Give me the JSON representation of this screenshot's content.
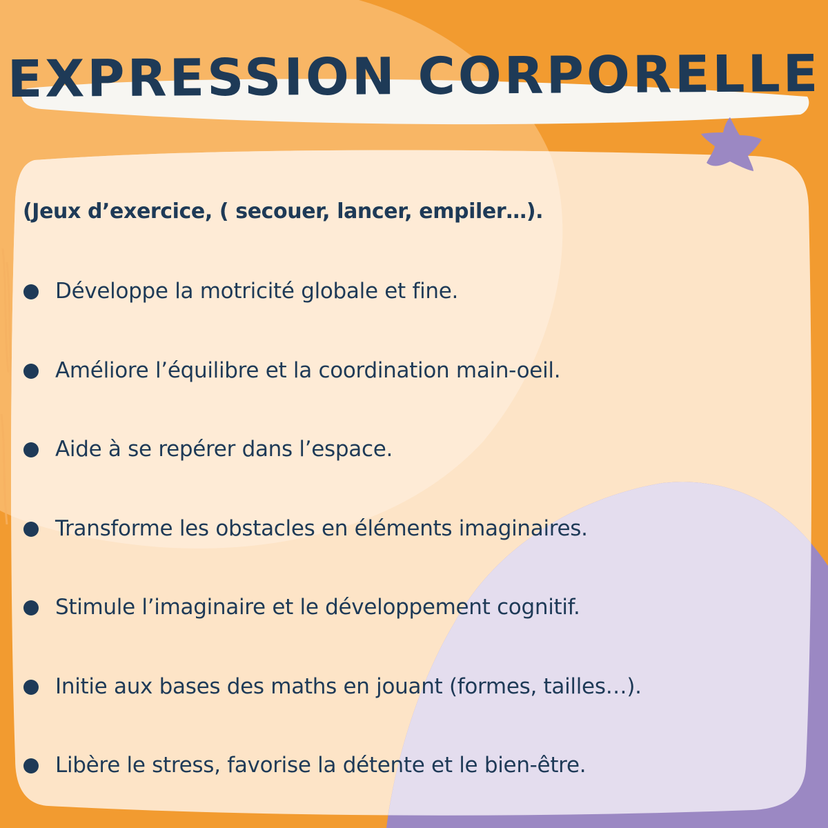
{
  "title": "Expression corporelle",
  "intro": "(Jeux d’exercice, ( secouer, lancer, empiler…).",
  "items": [
    "Développe la motricité globale et fine.",
    "Améliore l’équilibre et la coordination main-oeil.",
    "Aide à se repérer dans l’espace.",
    "Transforme les obstacles en éléments imaginaires.",
    "Stimule l’imaginaire et le développement cognitif.",
    "Initie aux bases des maths en jouant (formes, tailles…).",
    "Libère le stress, favorise la détente et le bien-être."
  ],
  "colors": {
    "background": "#F29B30",
    "light_orange_blob": "#F8B665",
    "card": "#FDE4C7",
    "lavender": "#E4DDEE",
    "purple": "#9B88C3",
    "navy": "#1E3A57",
    "title_banner": "#F7F6F2"
  },
  "icons": [
    "star-icon",
    "bullet-dot-icon"
  ]
}
